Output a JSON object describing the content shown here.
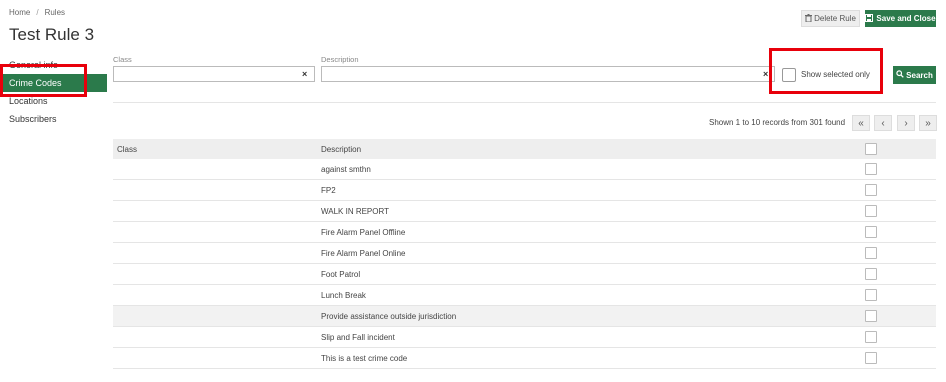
{
  "breadcrumb": {
    "home": "Home",
    "separator": "/",
    "current": "Rules"
  },
  "page_title": "Test Rule 3",
  "toolbar": {
    "delete_label": "Delete Rule",
    "save_label": "Save and Close"
  },
  "nav": {
    "items": [
      {
        "label": "General info"
      },
      {
        "label": "Crime Codes",
        "active": true
      },
      {
        "label": "Locations"
      },
      {
        "label": "Subscribers"
      }
    ]
  },
  "filters": {
    "class_label": "Class",
    "class_value": "",
    "description_label": "Description",
    "description_value": "",
    "clear_glyph": "×",
    "show_selected_label": "Show selected only",
    "search_label": "Search"
  },
  "pagination": {
    "summary": "Shown 1 to 10 records from 301 found",
    "first": "«",
    "prev": "‹",
    "next": "›",
    "last": "»"
  },
  "table": {
    "headers": {
      "class": "Class",
      "description": "Description"
    },
    "rows": [
      {
        "class": "",
        "description": "against smthn"
      },
      {
        "class": "",
        "description": "FP2"
      },
      {
        "class": "",
        "description": "WALK IN REPORT"
      },
      {
        "class": "",
        "description": "Fire Alarm Panel Offline"
      },
      {
        "class": "",
        "description": "Fire Alarm Panel Online"
      },
      {
        "class": "",
        "description": "Foot Patrol"
      },
      {
        "class": "",
        "description": "Lunch Break"
      },
      {
        "class": "",
        "description": "Provide assistance outside jurisdiction"
      },
      {
        "class": "",
        "description": "Slip and Fall incident"
      },
      {
        "class": "",
        "description": "This is a test crime code"
      }
    ]
  },
  "colors": {
    "accent": "#2b7a4b",
    "highlight": "#e8000b"
  }
}
